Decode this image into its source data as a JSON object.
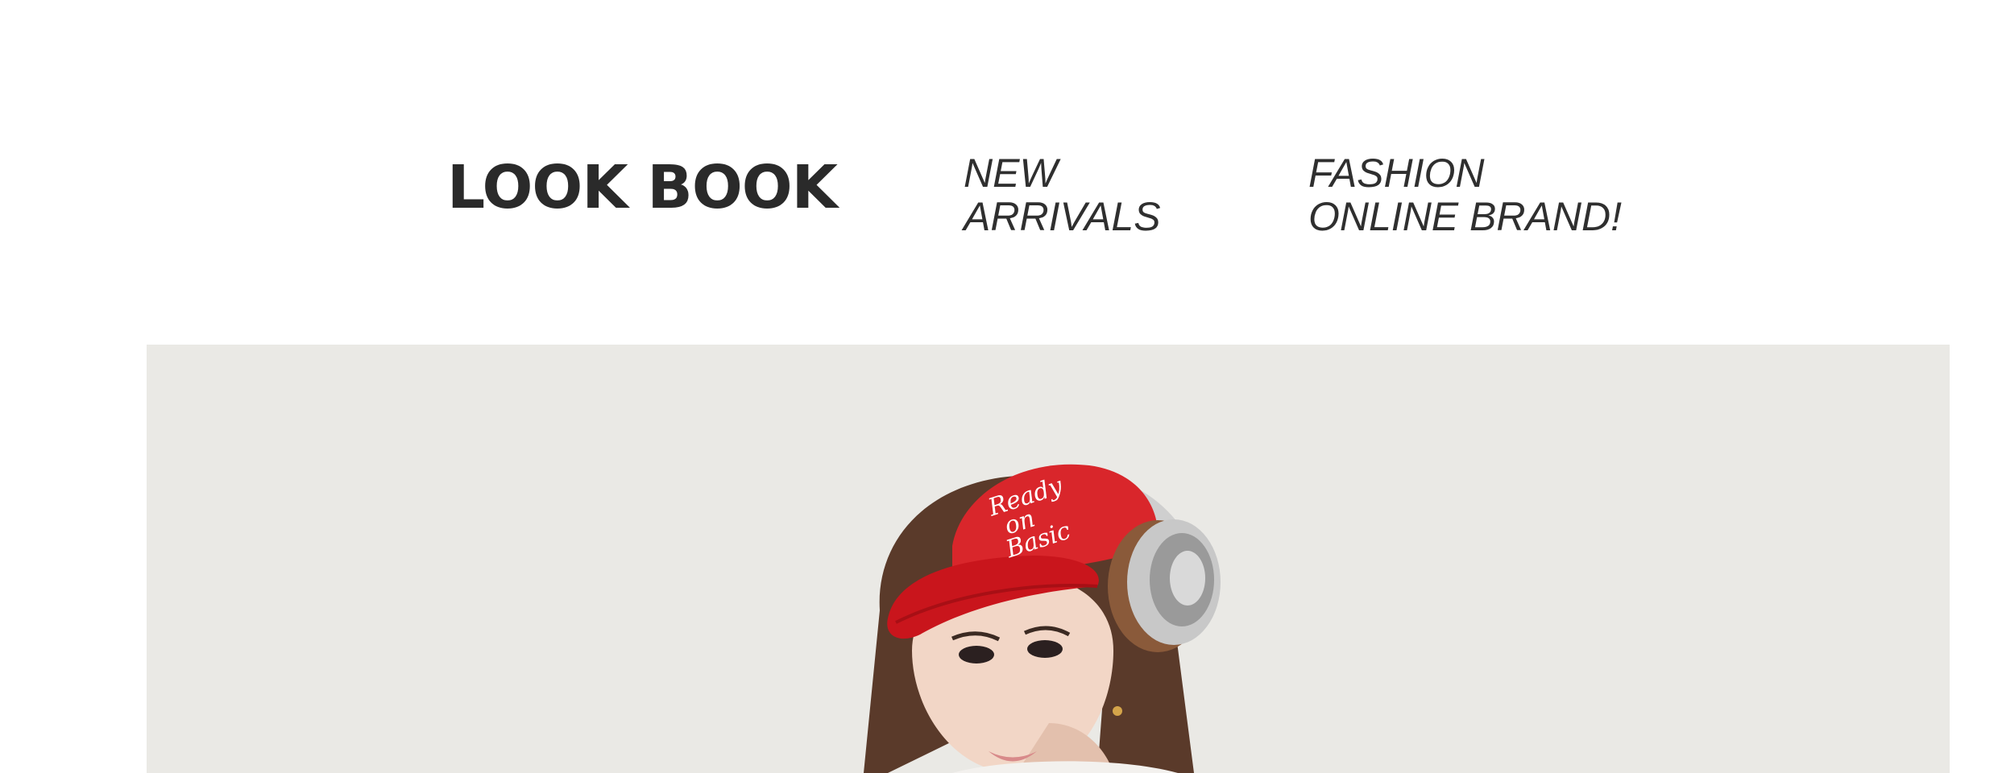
{
  "header": {
    "brand_title": "LOOK BOOK",
    "tagline_left": {
      "line1": "NEW",
      "line2": "ARRIVALS"
    },
    "tagline_right": {
      "line1": "FASHION",
      "line2": "ONLINE BRAND!"
    }
  },
  "hero": {
    "background_color": "#e9e7e3",
    "cap_text": {
      "line1": "Ready",
      "line2": "on",
      "line3": "Basic"
    },
    "cap_color": "#d9262b",
    "headphone_color": "#b9b9b9"
  }
}
